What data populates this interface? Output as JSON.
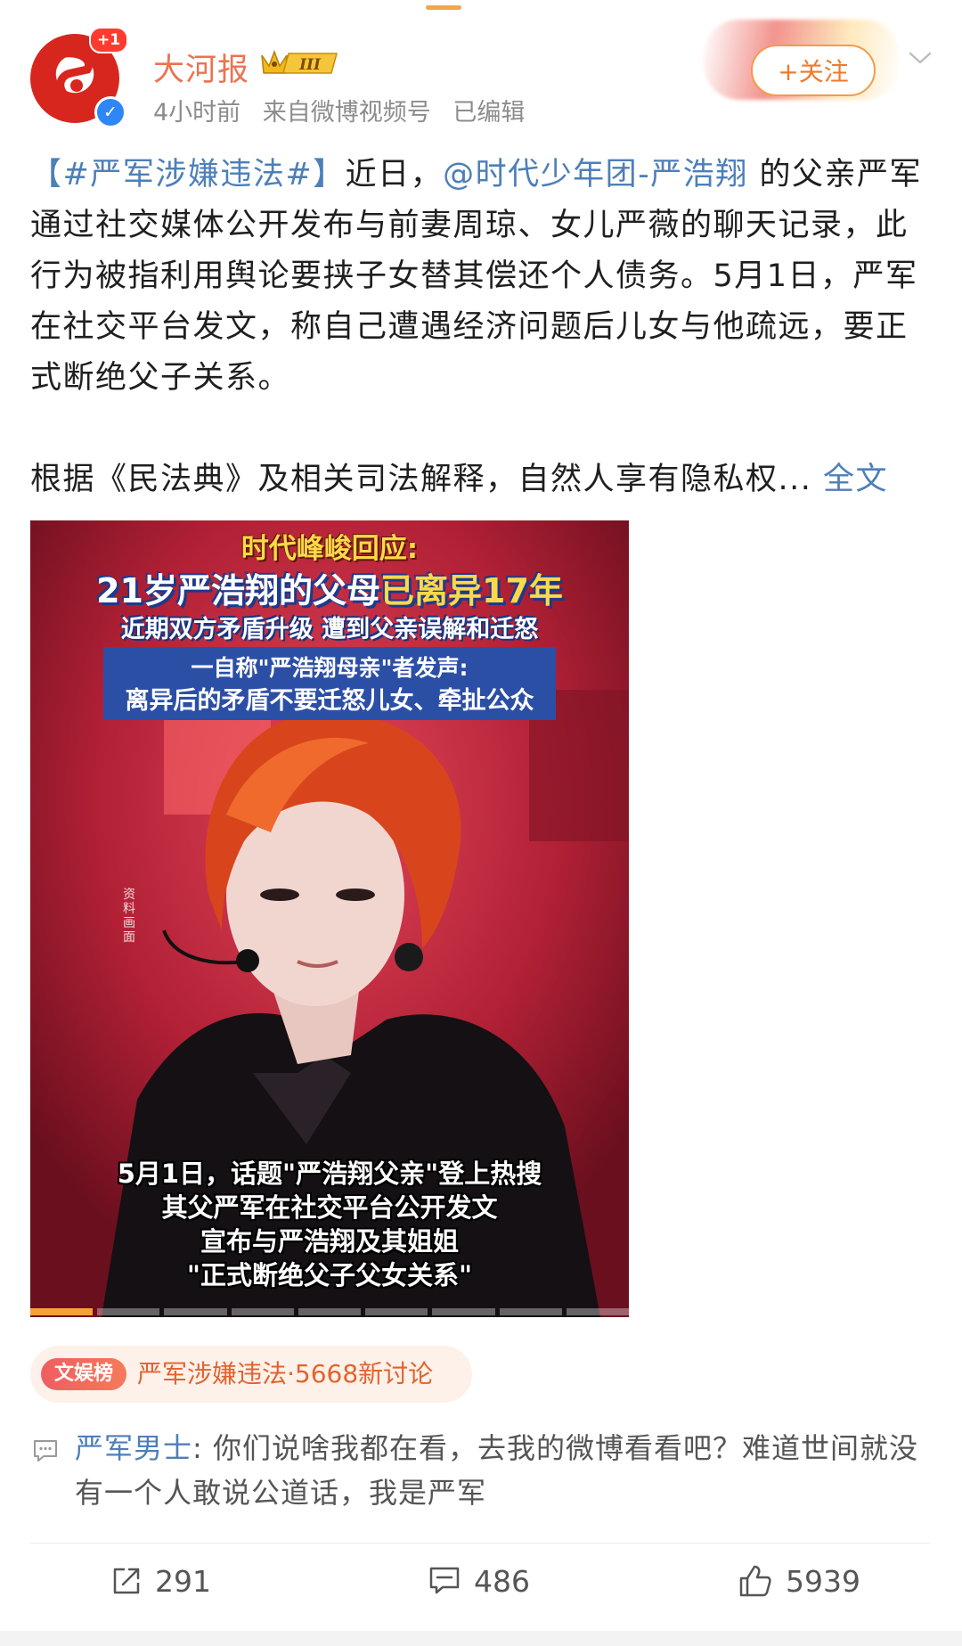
{
  "header": {
    "avatar_badge": "+1",
    "username": "大河报",
    "vip_level": "III",
    "time": "4小时前",
    "source": "来自微博视频号",
    "edited": "已编辑",
    "follow_label": "+关注"
  },
  "post": {
    "hashtag": "【#严军涉嫌违法#】",
    "text_1": "近日，",
    "mention": "@时代少年团-严浩翔",
    "text_2": " 的父亲严军通过社交媒体公开发布与前妻周琼、女儿严薇的聊天记录，此行为被指利用舆论要挟子女替其偿还个人债务。5月1日，严军在社交平台发文，称自己遭遇经济问题后儿女与他疏远，要正式断绝父子关系。",
    "text_3": "根据《民法典》及相关司法解释，自然人享有隐私权... ",
    "expand_label": "全文"
  },
  "video": {
    "title_line1": "时代峰峻回应:",
    "title_line2_a": "21岁严浩翔的父母",
    "title_line2_b": "已离异17年",
    "title_line3": "近期双方矛盾升级 遭到父亲误解和迁怒",
    "box_line1": "一自称\"严浩翔母亲\"者发声:",
    "box_line2": "离异后的矛盾不要迁怒儿女、牵扯公众",
    "side_note": "资料画面",
    "caption_1": "5月1日，话题\"严浩翔父亲\"登上热搜",
    "caption_2": "其父严军在社交平台公开发文",
    "caption_3": "宣布与严浩翔及其姐姐",
    "caption_4": "\"正式断绝父子父女关系\"",
    "progress_segments": 9
  },
  "topic": {
    "tag": "文娱榜",
    "text": "严军涉嫌违法·5668新讨论"
  },
  "comment": {
    "user": "严军男士",
    "text": ": 你们说啥我都在看，去我的微博看看吧？难道世间就没有一个人敢说公道话，我是严军"
  },
  "actions": {
    "repost_count": "291",
    "comment_count": "486",
    "like_count": "5939"
  },
  "icons": {
    "verified": "verified-v-icon",
    "more": "chevron-down-icon",
    "comment_bubble": "comment-bubble-icon",
    "repost": "repost-icon",
    "comment": "comment-icon",
    "like": "thumbs-up-icon"
  },
  "colors": {
    "brand_orange": "#eb7350",
    "link_blue": "#4d7fb8",
    "follow_orange": "#ee7a2c",
    "verified_blue": "#2f86f6",
    "avatar_red": "#d7261e"
  }
}
